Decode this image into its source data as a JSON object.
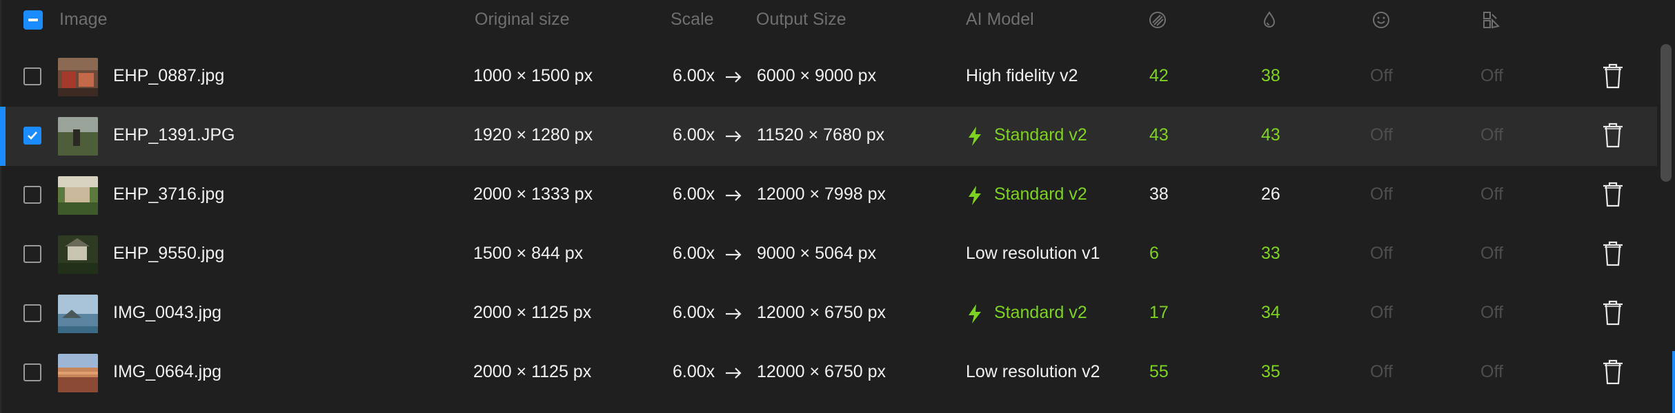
{
  "header": {
    "select_all": "partial",
    "image": "Image",
    "original_size": "Original size",
    "scale": "Scale",
    "output_size": "Output Size",
    "ai_model": "AI Model",
    "icons": [
      "noise-icon",
      "sharpen-icon",
      "face-icon",
      "color-icon"
    ]
  },
  "colors": {
    "accent": "#1a8cff",
    "green": "#7ed321",
    "off": "#4e4e4e"
  },
  "rows": [
    {
      "checked": false,
      "name": "EHP_0887.jpg",
      "original": "1000 × 1500 px",
      "scale": "6.00x",
      "output": "6000 × 9000 px",
      "model": "High fidelity v2",
      "model_highlight": false,
      "noise": "42",
      "noise_green": true,
      "sharpen": "38",
      "sharpen_green": true,
      "face": "Off",
      "color": "Off"
    },
    {
      "checked": true,
      "name": "EHP_1391.JPG",
      "original": "1920 × 1280 px",
      "scale": "6.00x",
      "output": "11520 × 7680 px",
      "model": "Standard v2",
      "model_highlight": true,
      "noise": "43",
      "noise_green": true,
      "sharpen": "43",
      "sharpen_green": true,
      "face": "Off",
      "color": "Off"
    },
    {
      "checked": false,
      "name": "EHP_3716.jpg",
      "original": "2000 × 1333 px",
      "scale": "6.00x",
      "output": "12000 × 7998 px",
      "model": "Standard v2",
      "model_highlight": true,
      "noise": "38",
      "noise_green": false,
      "sharpen": "26",
      "sharpen_green": false,
      "face": "Off",
      "color": "Off"
    },
    {
      "checked": false,
      "name": "EHP_9550.jpg",
      "original": "1500 × 844 px",
      "scale": "6.00x",
      "output": "9000 × 5064 px",
      "model": "Low resolution v1",
      "model_highlight": false,
      "noise": "6",
      "noise_green": true,
      "sharpen": "33",
      "sharpen_green": true,
      "face": "Off",
      "color": "Off"
    },
    {
      "checked": false,
      "name": "IMG_0043.jpg",
      "original": "2000 × 1125 px",
      "scale": "6.00x",
      "output": "12000 × 6750 px",
      "model": "Standard v2",
      "model_highlight": true,
      "noise": "17",
      "noise_green": true,
      "sharpen": "34",
      "sharpen_green": true,
      "face": "Off",
      "color": "Off"
    },
    {
      "checked": false,
      "name": "IMG_0664.jpg",
      "original": "2000 × 1125 px",
      "scale": "6.00x",
      "output": "12000 × 6750 px",
      "model": "Low resolution v2",
      "model_highlight": false,
      "noise": "55",
      "noise_green": true,
      "sharpen": "35",
      "sharpen_green": true,
      "face": "Off",
      "color": "Off"
    }
  ]
}
